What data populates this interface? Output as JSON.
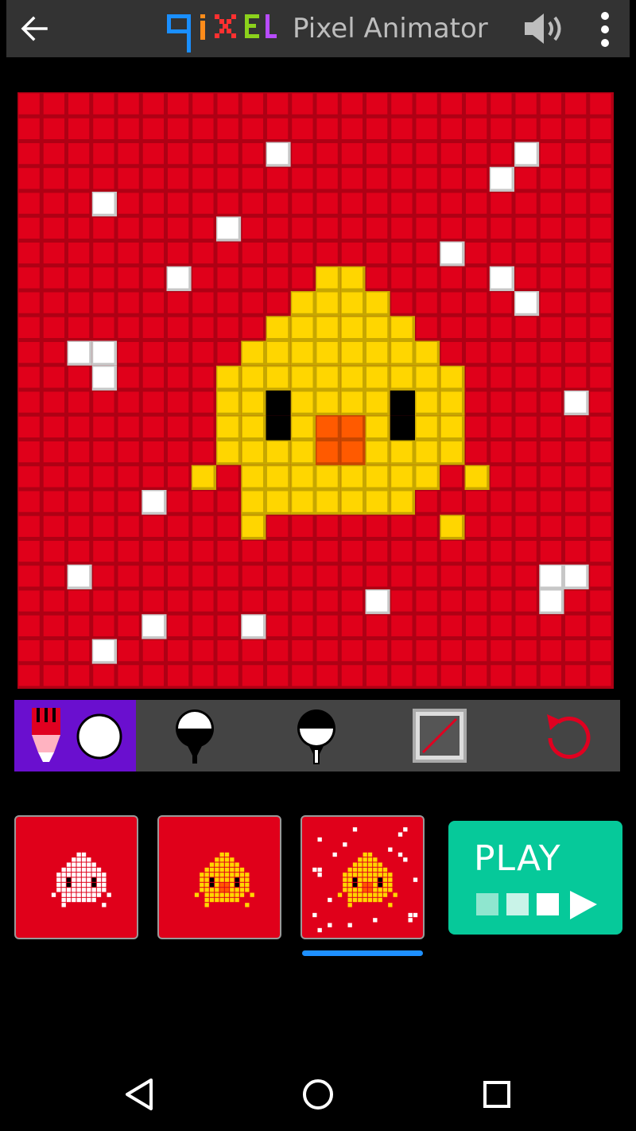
{
  "header": {
    "logo_text": "QIXEL",
    "title": "Pixel Animator",
    "back_icon": "arrow-left-icon",
    "sound_icon": "volume-up-icon",
    "menu_icon": "more-vertical-icon"
  },
  "canvas": {
    "grid_size": 24,
    "background_color": "#e0001a",
    "palette": {
      "W": "#ffffff",
      "Y": "#ffd600",
      "K": "#000000",
      "O": "#ff5a00"
    },
    "pixels": [
      "........................",
      "........................",
      "..........W.........W...",
      "...................W....",
      "...W....................",
      "........W...............",
      ".................W......",
      "......W.....YY.....W....",
      "...........YYYY.....W...",
      "..........YYYYYY........",
      "..WW.....YYYYYYYY.......",
      "...W....YYYYYYYYYY......",
      "........YYKYYYYKYY....W.",
      "........YYKYOOYKYY......",
      "........YYYYOOYYYY......",
      ".......Y.YYYYYYYY.Y.....",
      ".....W...YYYYYYY........",
      ".........Y.......Y......",
      "........................",
      "..W..................WW.",
      "..............W......W..",
      ".....W...W..............",
      "...W....................",
      "........................"
    ]
  },
  "tools": {
    "pencil_icon": "pencil-icon",
    "current_color": "#ffffff",
    "brush_fill_icon": "fill-brush-icon",
    "brush_drip_icon": "drip-brush-icon",
    "clear_icon": "clear-frame-icon",
    "undo_icon": "undo-icon"
  },
  "frames": {
    "selected_index": 2,
    "items": [
      {
        "name": "frame-1"
      },
      {
        "name": "frame-2"
      },
      {
        "name": "frame-3"
      }
    ]
  },
  "play": {
    "label": "PLAY"
  },
  "navbar": {
    "back_icon": "nav-back-icon",
    "home_icon": "nav-home-icon",
    "recents_icon": "nav-recents-icon"
  }
}
